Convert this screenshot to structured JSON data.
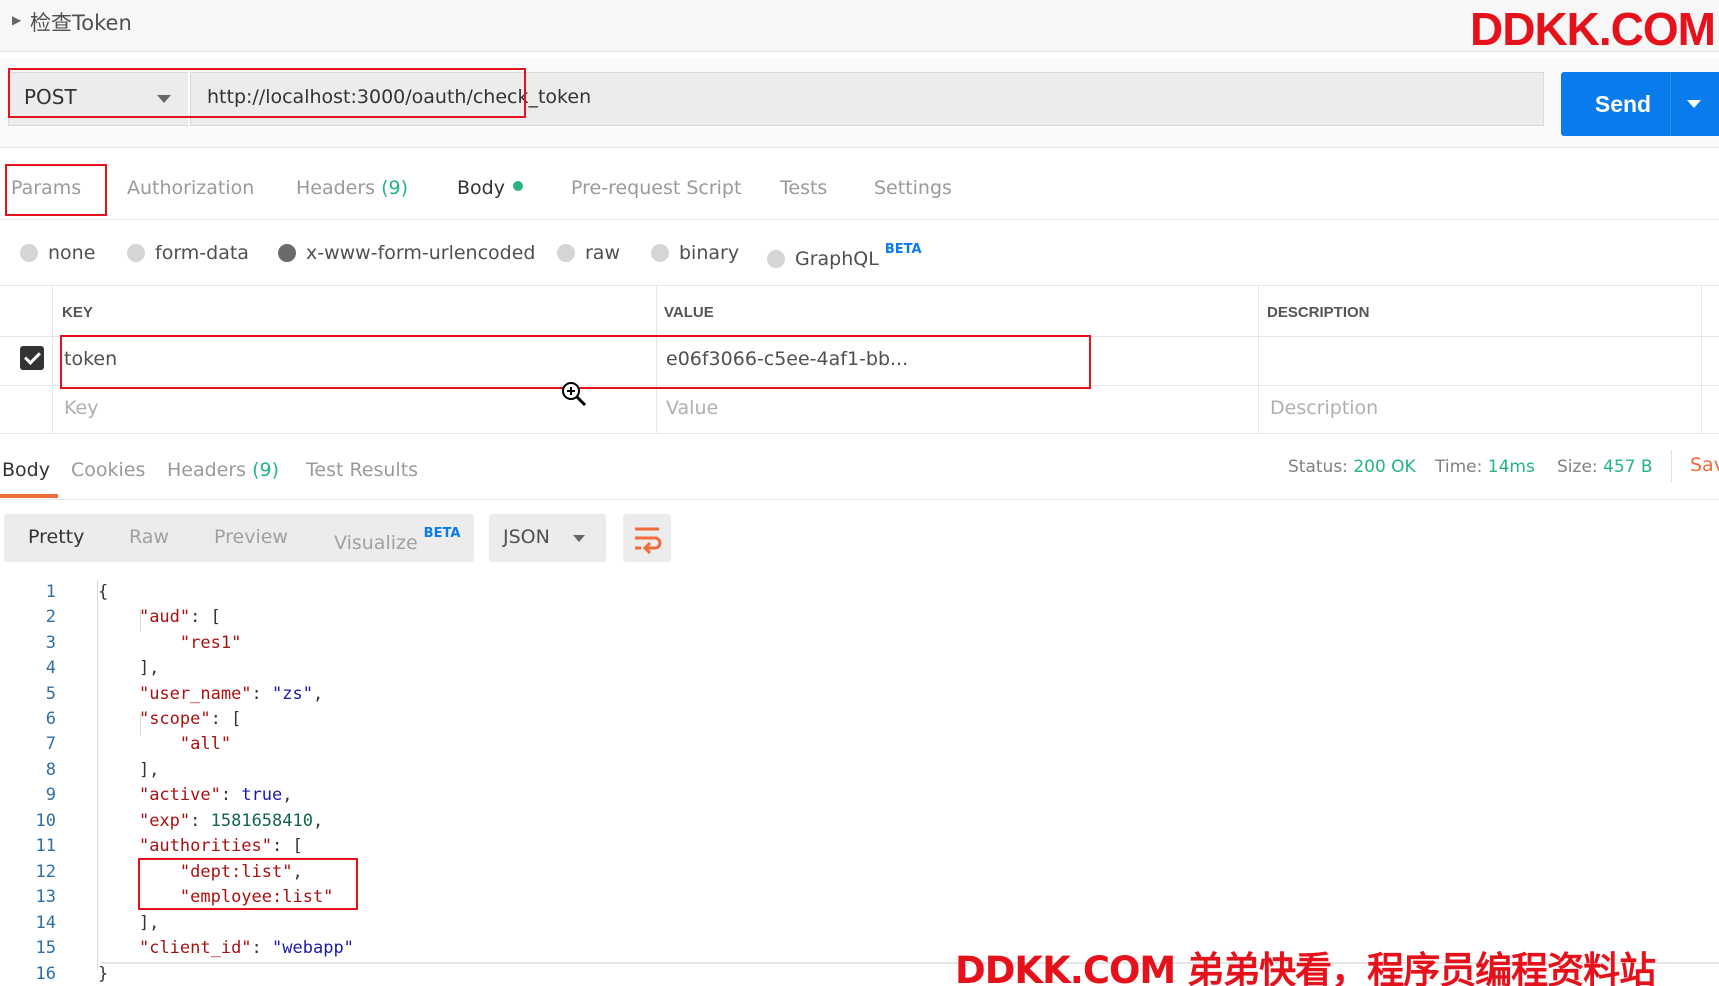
{
  "header": {
    "title": "检查Token",
    "watermark": "DDKK.COM"
  },
  "request": {
    "method": "POST",
    "url": "http://localhost:3000/oauth/check_token",
    "send_label": "Send"
  },
  "tabs": [
    {
      "label": "Params"
    },
    {
      "label": "Authorization"
    },
    {
      "label": "Headers",
      "count": "(9)"
    },
    {
      "label": "Body"
    },
    {
      "label": "Pre-request Script"
    },
    {
      "label": "Tests"
    },
    {
      "label": "Settings"
    }
  ],
  "body_types": {
    "none": "none",
    "form_data": "form-data",
    "urlencoded": "x-www-form-urlencoded",
    "raw": "raw",
    "binary": "binary",
    "graphql": "GraphQL",
    "beta": "BETA",
    "selected": "x-www-form-urlencoded"
  },
  "params_table": {
    "headers": {
      "key": "KEY",
      "value": "VALUE",
      "description": "DESCRIPTION"
    },
    "rows": [
      {
        "key": "token",
        "value": "e06f3066-c5ee-4af1-bb...",
        "checked": true
      }
    ],
    "placeholders": {
      "key": "Key",
      "value": "Value",
      "description": "Description"
    }
  },
  "response_tabs": {
    "body": "Body",
    "cookies": "Cookies",
    "headers": "Headers",
    "headers_count": "(9)",
    "test_results": "Test Results"
  },
  "response_status": {
    "status_label": "Status:",
    "status_value": "200 OK",
    "time_label": "Time:",
    "time_value": "14ms",
    "size_label": "Size:",
    "size_value": "457 B",
    "save_label": "Sav"
  },
  "view_options": {
    "pretty": "Pretty",
    "raw": "Raw",
    "preview": "Preview",
    "visualize": "Visualize",
    "beta": "BETA",
    "format": "JSON"
  },
  "code_lines": [
    "1",
    "2",
    "3",
    "4",
    "5",
    "6",
    "7",
    "8",
    "9",
    "10",
    "11",
    "12",
    "13",
    "14",
    "15",
    "16"
  ],
  "response_json": {
    "open": "{",
    "aud_key": "\"aud\"",
    "res1": "\"res1\"",
    "user_name_key": "\"user_name\"",
    "user_name_val": "\"zs\"",
    "scope_key": "\"scope\"",
    "all": "\"all\"",
    "active_key": "\"active\"",
    "active_val": "true",
    "exp_key": "\"exp\"",
    "exp_val": "1581658410",
    "authorities_key": "\"authorities\"",
    "dept_list": "\"dept:list\"",
    "employee_list": "\"employee:list\"",
    "client_id_key": "\"client_id\"",
    "client_id_val": "\"webapp\"",
    "close": "}"
  },
  "footer_watermark": "DDKK.COM 弟弟快看，程序员编程资料站",
  "colors": {
    "accent": "#097bed",
    "success": "#26b47f",
    "highlight": "#e6121b",
    "active_tab": "#f26b3a"
  }
}
